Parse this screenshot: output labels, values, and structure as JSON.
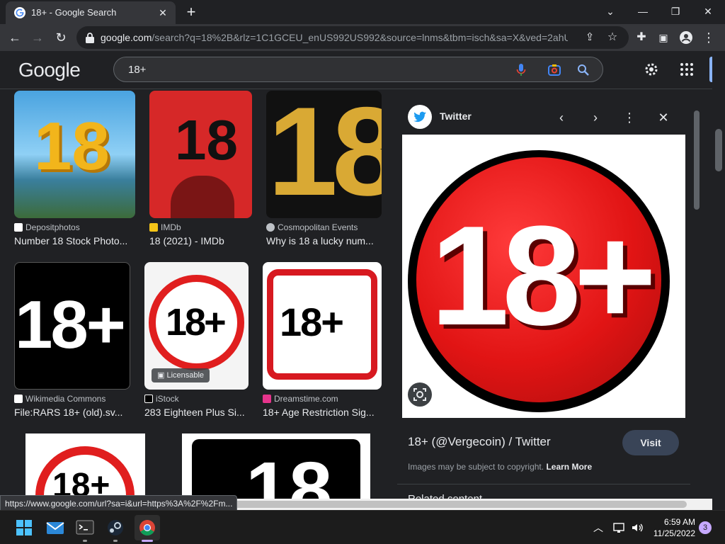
{
  "browser": {
    "tab_title": "18+ - Google Search",
    "url_host": "google.com",
    "url_rest": "/search?q=18%2B&rlz=1C1GCEU_enUS992US992&source=lnms&tbm=isch&sa=X&ved=2ahU...",
    "status_url": "https://www.google.com/url?sa=i&url=https%3A%2F%2Fm..."
  },
  "google": {
    "logo": "Google",
    "query": "18+"
  },
  "results": [
    {
      "source": "Depositphotos",
      "caption": "Number 18 Stock Photo..."
    },
    {
      "source": "IMDb",
      "caption": "18 (2021) - IMDb"
    },
    {
      "source": "Cosmopolitan Events",
      "caption": "Why is 18 a lucky num..."
    },
    {
      "source": "Wikimedia Commons",
      "caption": "File:RARS 18+ (old).sv..."
    },
    {
      "source": "iStock",
      "caption": "283 Eighteen Plus Si...",
      "badge": "Licensable"
    },
    {
      "source": "Dreamstime.com",
      "caption": "18+ Age Restriction Sig..."
    }
  ],
  "thumb_text": {
    "t1": "18",
    "t2": "18",
    "t3": "18",
    "t4": "18+",
    "t5": "18+",
    "t6": "18+",
    "t7": "18+",
    "t8": "18"
  },
  "panel": {
    "site": "Twitter",
    "preview_text": "18+",
    "title": "18+ (@Vergecoin) / Twitter",
    "visit": "Visit",
    "copyright": "Images may be subject to copyright.",
    "learn_more": "Learn More",
    "related": "Related content"
  },
  "taskbar": {
    "time": "6:59 AM",
    "date": "11/25/2022",
    "notifications": "3"
  }
}
